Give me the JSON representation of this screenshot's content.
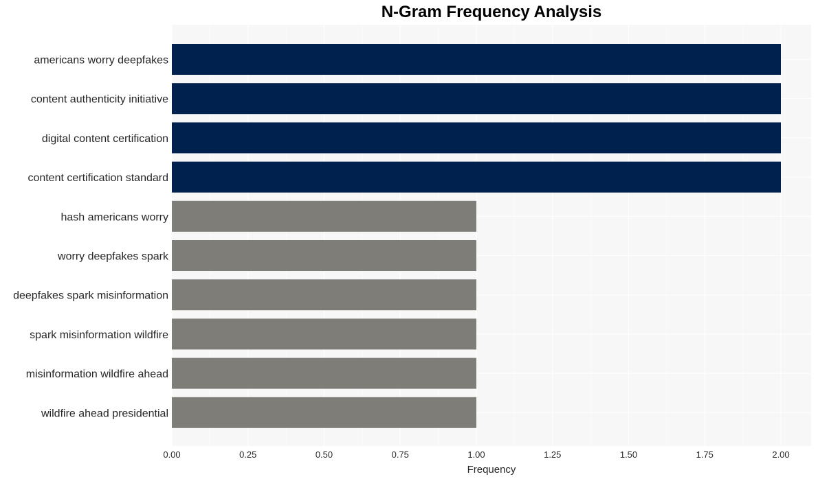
{
  "chart_data": {
    "type": "bar",
    "orientation": "horizontal",
    "title": "N-Gram Frequency Analysis",
    "xlabel": "Frequency",
    "ylabel": "",
    "xlim": [
      0,
      2.1
    ],
    "grid": true,
    "xticks": [
      0.0,
      0.25,
      0.5,
      0.75,
      1.0,
      1.25,
      1.5,
      1.75,
      2.0
    ],
    "xtick_labels": [
      "0.00",
      "0.25",
      "0.50",
      "0.75",
      "1.00",
      "1.25",
      "1.50",
      "1.75",
      "2.00"
    ],
    "categories": [
      "americans worry deepfakes",
      "content authenticity initiative",
      "digital content certification",
      "content certification standard",
      "hash americans worry",
      "worry deepfakes spark",
      "deepfakes spark misinformation",
      "spark misinformation wildfire",
      "misinformation wildfire ahead",
      "wildfire ahead presidential"
    ],
    "values": [
      2,
      2,
      2,
      2,
      1,
      1,
      1,
      1,
      1,
      1
    ],
    "colors": {
      "high": "#00204e",
      "low": "#7f7d78",
      "plot_background": "#f7f7f7",
      "grid": "#ffffff"
    }
  }
}
